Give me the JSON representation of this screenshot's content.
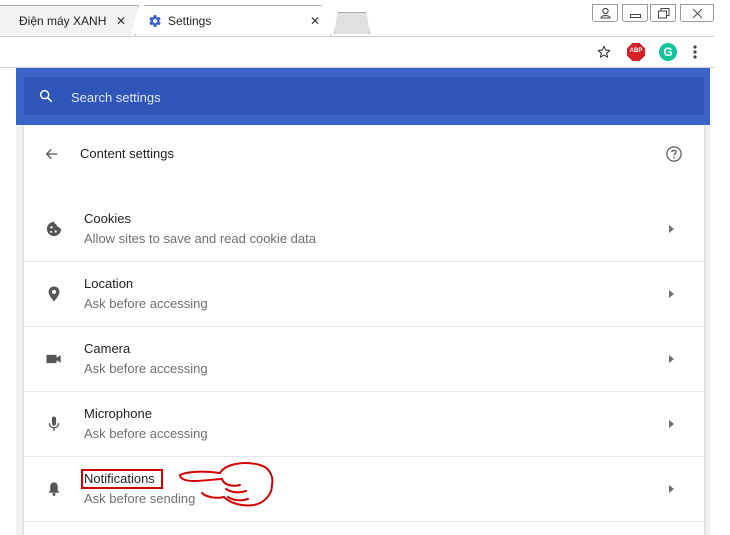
{
  "tabs": [
    {
      "label": "Điện máy XANH",
      "close": "✕"
    },
    {
      "label": "Settings",
      "close": "✕"
    }
  ],
  "search": {
    "placeholder": "Search settings"
  },
  "content_settings": {
    "title": "Content settings"
  },
  "extensions": {
    "abp": "ABP",
    "grammarly": "G"
  },
  "items": [
    {
      "title": "Cookies",
      "subtitle": "Allow sites to save and read cookie data",
      "icon": "cookie-icon"
    },
    {
      "title": "Location",
      "subtitle": "Ask before accessing",
      "icon": "location-pin-icon"
    },
    {
      "title": "Camera",
      "subtitle": "Ask before accessing",
      "icon": "camera-icon"
    },
    {
      "title": "Microphone",
      "subtitle": "Ask before accessing",
      "icon": "microphone-icon"
    },
    {
      "title": "Notifications",
      "subtitle": "Ask before sending",
      "icon": "bell-icon"
    }
  ],
  "colors": {
    "header_blue": "#3b64c8",
    "search_blue": "#2e55b7",
    "annotation_red": "#d20000"
  }
}
